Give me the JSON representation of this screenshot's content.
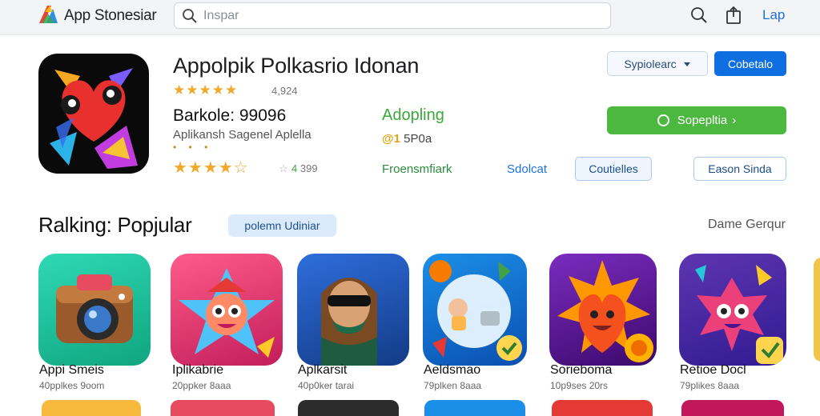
{
  "topbar": {
    "brand": "App Stonesiar",
    "search_placeholder": "Inspar",
    "login_label": "Lap",
    "icons": [
      "search-icon",
      "share-icon"
    ]
  },
  "app": {
    "title": "Appolpik Polkasrio Idonan",
    "stars": "★★★★★",
    "rating_count": "4,924",
    "price": "Barkole: 99096",
    "subtitle": "Aplikansh Sagenel Aplella",
    "dots": "• • •",
    "stars_row2": "★★★★☆",
    "stars_row2_extra": "☆",
    "stars_row2_count_prefix": "4",
    "stars_row2_count": "399",
    "developer_name": "Adopling",
    "developer_meta_prefix": "@1",
    "developer_meta": "5P0a",
    "developer_link": "Froensmfiark",
    "developer_link2": "Sdolcat",
    "dropdown_label": "Sypiolearc",
    "primary_label": "Cobetalo",
    "install_label": "Sopepltia",
    "install_chevron": "›",
    "outline1_label": "Coutielles",
    "outline2_label": "Eason Sinda"
  },
  "section": {
    "title": "Ralking: Popjular",
    "chip_label": "polemn Udiniar",
    "see_all": "Dame Gerqur"
  },
  "apps": [
    {
      "name": "Appi Smeis",
      "meta": "40pplkes 9oom"
    },
    {
      "name": "Iplikabrie",
      "meta": "20ppker 8aaa"
    },
    {
      "name": "Aplkarsit",
      "meta": "40p0ker tarai"
    },
    {
      "name": "Aeldsmao",
      "meta": "79plken 8aaa"
    },
    {
      "name": "Sorieboma",
      "meta": "10p9ses 20rs"
    },
    {
      "name": "Retioe Docl",
      "meta": "79plikes 8aaa"
    }
  ],
  "colors": {
    "accent": "#0f6fe0",
    "install": "#4cb83f",
    "star": "#f0a92a",
    "developer": "#3aa83a"
  }
}
